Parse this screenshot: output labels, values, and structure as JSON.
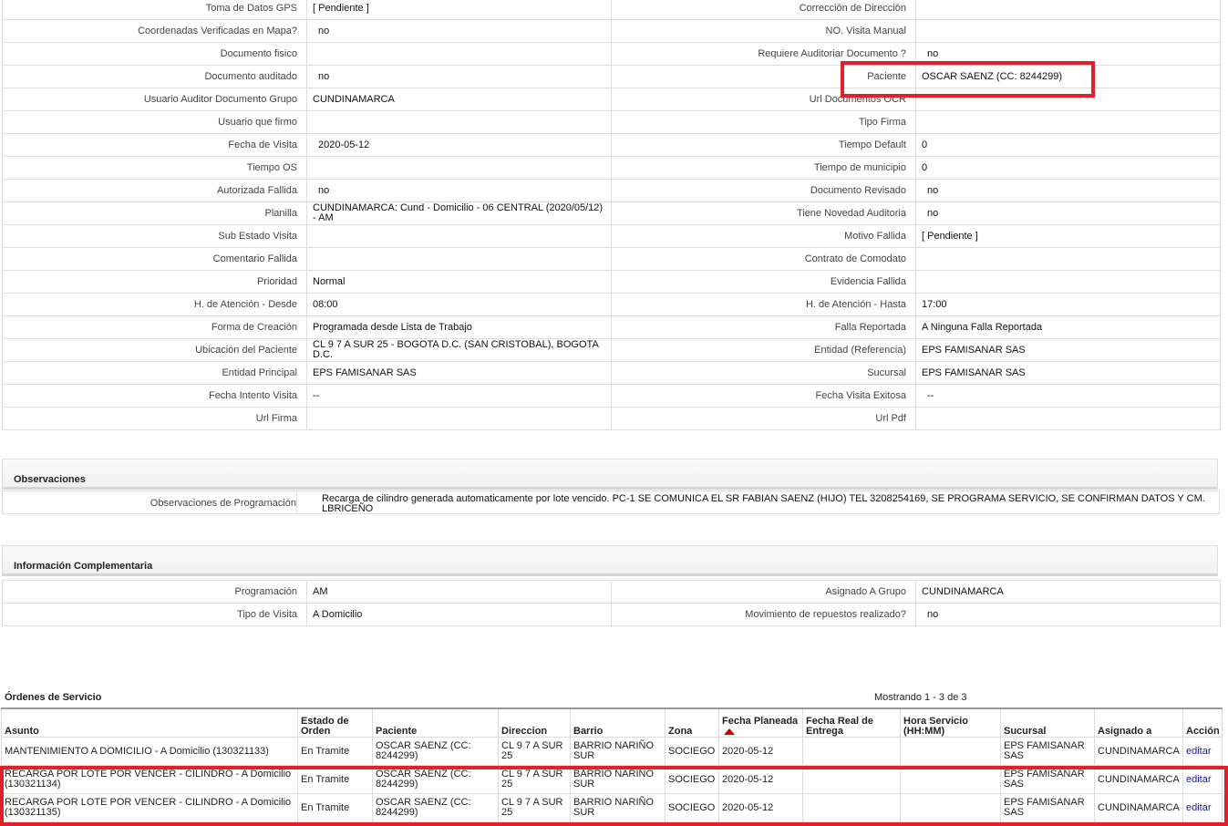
{
  "main_fields": [
    {
      "l1": "Toma de Datos GPS",
      "v1": "[ Pendiente ]",
      "l2": "Corrección de Dirección",
      "v2": ""
    },
    {
      "l1": "Coordenadas Verificadas en Mapa?",
      "v1": "no",
      "l2": "NO. Visita Manual",
      "v2": ""
    },
    {
      "l1": "Documento fisico",
      "v1": "",
      "l2": "Requiere Auditoriar Documento ?",
      "v2": "no"
    },
    {
      "l1": "Documento auditado",
      "v1": "no",
      "l2": "Paciente",
      "v2": "OSCAR SAENZ (CC: 8244299)"
    },
    {
      "l1": "Usuario Auditor Documento Grupo",
      "v1": "CUNDINAMARCA",
      "l2": "Url Documentos OCR",
      "v2": ""
    },
    {
      "l1": "Usuario que firmo",
      "v1": "",
      "l2": "Tipo Firma",
      "v2": ""
    },
    {
      "l1": "Fecha de Visita",
      "v1": "2020-05-12",
      "l2": "Tiempo Default",
      "v2": "0"
    },
    {
      "l1": "Tiempo OS",
      "v1": "",
      "l2": "Tiempo de municipio",
      "v2": "0"
    },
    {
      "l1": "Autorizada Fallida",
      "v1": "no",
      "l2": "Documento Revisado",
      "v2": "no"
    },
    {
      "l1": "Planilla",
      "v1": "CUNDINAMARCA: Cund - Domicilio - 06 CENTRAL (2020/05/12) - AM",
      "l2": "Tiene Novedad Auditoria",
      "v2": "no"
    },
    {
      "l1": "Sub Estado Visita",
      "v1": "",
      "l2": "Motivo Fallida",
      "v2": "[ Pendiente ]"
    },
    {
      "l1": "Comentario Fallida",
      "v1": "",
      "l2": "Contrato de Comodato",
      "v2": ""
    },
    {
      "l1": "Prioridad",
      "v1": "Normal",
      "l2": "Evidencia Fallida",
      "v2": ""
    },
    {
      "l1": "H. de Atención - Desde",
      "v1": "08:00",
      "l2": "H. de Atención - Hasta",
      "v2": "17:00"
    },
    {
      "l1": "Forma de Creación",
      "v1": "Programada desde Lista de Trabajo",
      "l2": "Falla Reportada",
      "v2": "A Ninguna Falla Reportada"
    },
    {
      "l1": "Ubicación del Paciente",
      "v1": "CL 9 7 A SUR 25 - BOGOTA D.C. (SAN CRISTOBAL), BOGOTA D.C.",
      "l2": "Entidad (Referencia)",
      "v2": "EPS FAMISANAR SAS"
    },
    {
      "l1": "Entidad Principal",
      "v1": "EPS FAMISANAR SAS",
      "l2": "Sucursal",
      "v2": "EPS FAMISANAR SAS"
    },
    {
      "l1": "Fecha Intento Visita",
      "v1": "--",
      "l2": "Fecha Visita Exitosa",
      "v2": "--"
    },
    {
      "l1": "Url Firma",
      "v1": "",
      "l2": "Url Pdf",
      "v2": ""
    }
  ],
  "observaciones": {
    "title": "Observaciones",
    "label": "Observaciones de Programación",
    "value": "Recarga de cilindro generada automaticamente por lote vencido. PC-1 SE COMUNICA EL SR FABIAN SAENZ (HIJO) TEL 3208254169, SE PROGRAMA SERVICIO, SE CONFIRMAN DATOS Y CM. LBRICEÑO"
  },
  "complementaria": {
    "title": "Información Complementaria",
    "rows": [
      {
        "l1": "Programación",
        "v1": "AM",
        "l2": "Asignado A Grupo",
        "v2": "CUNDINAMARCA"
      },
      {
        "l1": "Tipo de Visita",
        "v1": "A Domicilio",
        "l2": "Movimiento de repuestos realizado?",
        "v2": "no"
      }
    ]
  },
  "ordenes": {
    "title": "Órdenes de Servicio",
    "showing": "Mostrando 1 - 3 de 3",
    "headers": [
      "Asunto",
      "Estado de Orden",
      "Paciente",
      "Direccion",
      "Barrio",
      "Zona",
      "Fecha Planeada",
      "Fecha Real de Entrega",
      "Hora Servicio (HH:MM)",
      "Sucursal",
      "Asignado a",
      "Acción"
    ],
    "rows": [
      {
        "asunto": "MANTENIMIENTO A DOMICILIO - A Domicilio (130321133)",
        "estado": "En Tramite",
        "paciente": "OSCAR SAENZ (CC: 8244299)",
        "direccion": "CL 9 7 A SUR 25",
        "barrio": "BARRIO NARIÑO SUR",
        "zona": "SOCIEGO",
        "fecha": "2020-05-12",
        "fecha_real": "",
        "hora": "",
        "sucursal": "EPS FAMISANAR SAS",
        "asignado": "CUNDINAMARCA",
        "accion": "editar"
      },
      {
        "asunto": "RECARGA POR LOTE POR VENCER - CILINDRO - A Domicilio (130321134)",
        "estado": "En Tramite",
        "paciente": "OSCAR SAENZ (CC: 8244299)",
        "direccion": "CL 9 7 A SUR 25",
        "barrio": "BARRIO NARIÑO SUR",
        "zona": "SOCIEGO",
        "fecha": "2020-05-12",
        "fecha_real": "",
        "hora": "",
        "sucursal": "EPS FAMISANAR SAS",
        "asignado": "CUNDINAMARCA",
        "accion": "editar"
      },
      {
        "asunto": "RECARGA POR LOTE POR VENCER - CILINDRO - A Domicilio (130321135)",
        "estado": "En Tramite",
        "paciente": "OSCAR SAENZ (CC: 8244299)",
        "direccion": "CL 9 7 A SUR 25",
        "barrio": "BARRIO NARIÑO SUR",
        "zona": "SOCIEGO",
        "fecha": "2020-05-12",
        "fecha_real": "",
        "hora": "",
        "sucursal": "EPS FAMISANAR SAS",
        "asignado": "CUNDINAMARCA",
        "accion": "editar"
      }
    ]
  },
  "colors": {
    "highlight": "#e0202b",
    "link": "#1a1a99",
    "sort_arrow": "#cc0000"
  }
}
